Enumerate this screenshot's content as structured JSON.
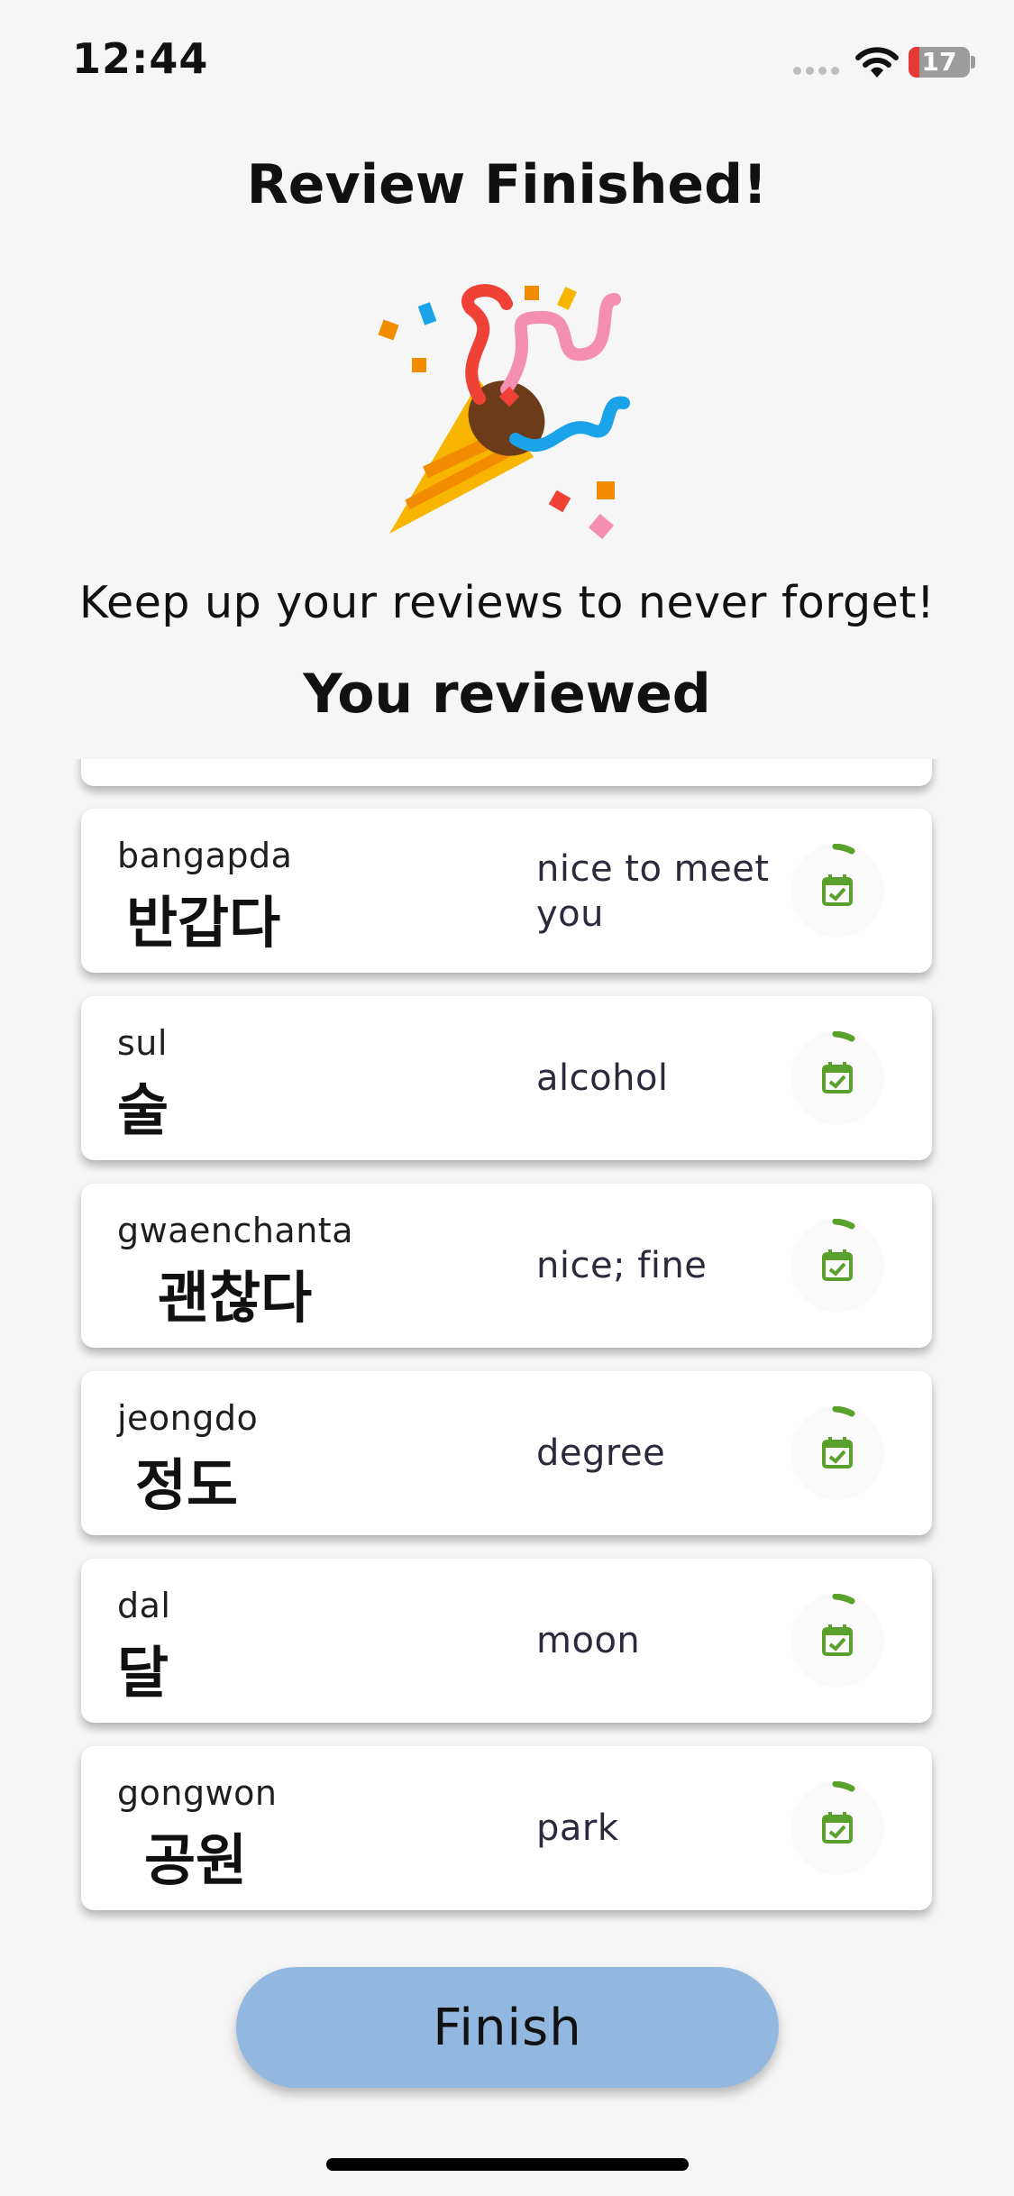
{
  "status_bar": {
    "time": "12:44",
    "battery": "17"
  },
  "header": {
    "title": "Review Finished!",
    "subtitle": "Keep up your reviews to never forget!",
    "section_title": "You reviewed"
  },
  "colors": {
    "accent_green": "#5aa02c",
    "finish_button": "#93b8e0",
    "background": "#f6f6f6"
  },
  "cards": [
    {
      "romanization": "bangapda",
      "hangul": "반갑다",
      "meaning": "nice to meet you",
      "icon": "calendar-check-icon"
    },
    {
      "romanization": "sul",
      "hangul": "술",
      "meaning": "alcohol",
      "icon": "calendar-check-icon"
    },
    {
      "romanization": "gwaenchanta",
      "hangul": "괜찮다",
      "meaning": "nice; fine",
      "icon": "calendar-check-icon"
    },
    {
      "romanization": "jeongdo",
      "hangul": "정도",
      "meaning": "degree",
      "icon": "calendar-check-icon"
    },
    {
      "romanization": "dal",
      "hangul": "달",
      "meaning": "moon",
      "icon": "calendar-check-icon"
    },
    {
      "romanization": "gongwon",
      "hangul": "공원",
      "meaning": "park",
      "icon": "calendar-check-icon"
    }
  ],
  "finish_button": {
    "label": "Finish"
  }
}
